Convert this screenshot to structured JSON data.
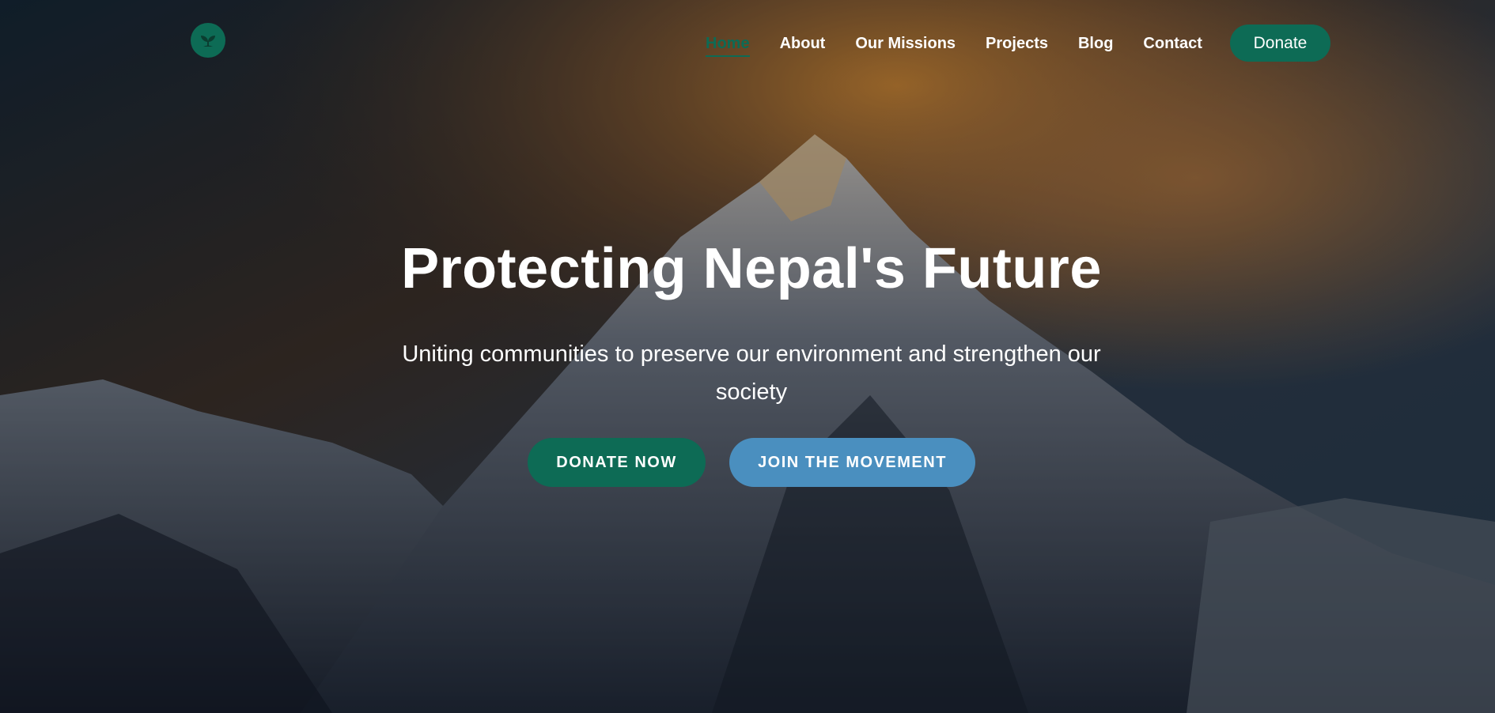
{
  "nav": {
    "logo_icon": "leaf-sprout-icon",
    "links": [
      "Home",
      "About",
      "Our Missions",
      "Projects",
      "Blog",
      "Contact"
    ],
    "active": "Home",
    "donate_label": "Donate"
  },
  "hero": {
    "title": "Protecting Nepal's Future",
    "subtitle": "Uniting communities to preserve our environment and strengthen our society",
    "primary_cta": "DONATE NOW",
    "secondary_cta": "JOIN THE MOVEMENT"
  },
  "colors": {
    "brand_green": "#0d6b55",
    "accent_blue": "#4a8fbf",
    "text_white": "#ffffff"
  }
}
